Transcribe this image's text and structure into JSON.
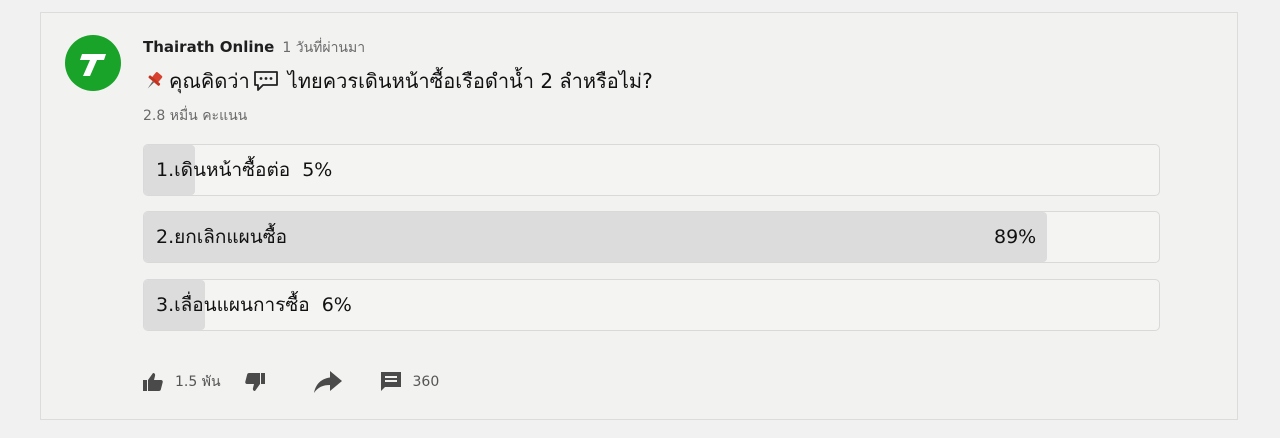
{
  "post": {
    "channel": "Thairath Online",
    "time": "1 วันที่ผ่านมา",
    "question": "คุณคิดว่า",
    "question_rest": "ไทยควรเดินหน้าซื้อเรือดำน้ำ 2 ลำหรือไม่?",
    "votes": "2.8 หมื่น คะแนน"
  },
  "poll": {
    "options": [
      {
        "label": "1.เดินหน้าซื้อต่อ",
        "percent_text": "5%",
        "percent": 5
      },
      {
        "label": "2.ยกเลิกแผนซื้อ",
        "percent_text": "89%",
        "percent": 89
      },
      {
        "label": "3.เลื่อนแผนการซื้อ",
        "percent_text": "6%",
        "percent": 6
      }
    ]
  },
  "actions": {
    "like_count": "1.5 พัน",
    "comment_count": "360"
  },
  "icons": {
    "avatar": "thairath-logo",
    "pin": "pushpin-icon",
    "speech": "speech-bubble-icon",
    "like": "thumb-up-icon",
    "dislike": "thumb-down-icon",
    "share": "share-arrow-icon",
    "comment": "comment-icon"
  },
  "colors": {
    "avatar_bg": "#1aa329",
    "poll_fill": "#dcdcdc",
    "background": "#f2f2f1"
  }
}
